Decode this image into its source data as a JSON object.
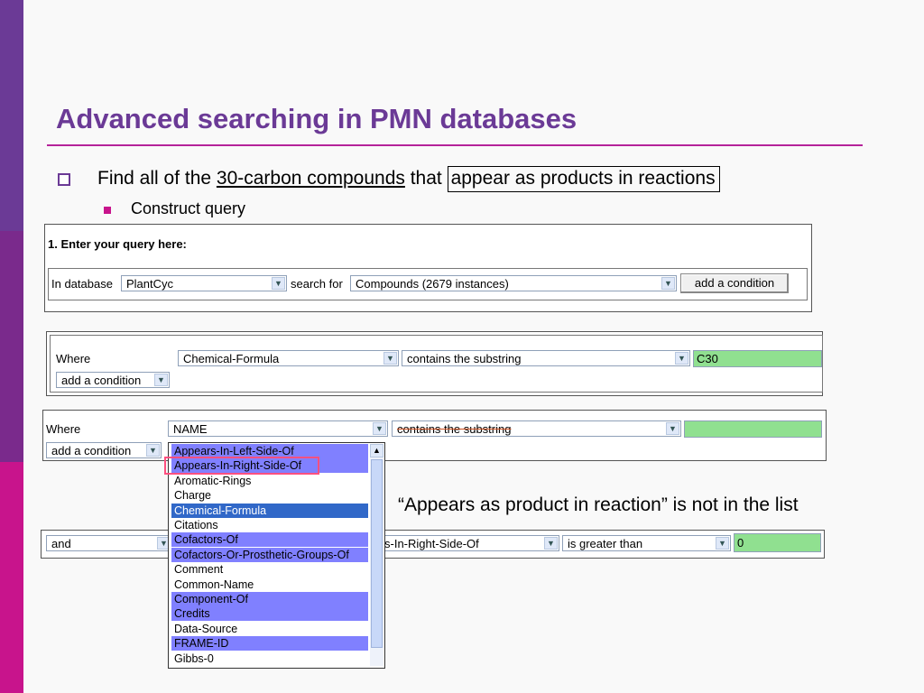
{
  "slide": {
    "title": "Advanced searching in PMN databases",
    "bullet1_prefix": "Find all of the ",
    "bullet1_underlined": "30-carbon compounds",
    "bullet1_middle": " that ",
    "bullet1_boxed": "appear as products in reactions",
    "bullet2": "Construct query",
    "callout": "“Appears as product in reaction” is not in the list"
  },
  "query_panel": {
    "heading": "1. Enter your query here:",
    "in_database_label": "In database",
    "database_value": "PlantCyc",
    "search_for_label": "search for",
    "search_for_value": "Compounds (2679 instances)",
    "add_condition_button": "add a condition"
  },
  "condition1": {
    "where_label": "Where",
    "attribute": "Chemical-Formula",
    "operator": "contains the substring",
    "value": "C30",
    "add_condition": "add a condition"
  },
  "condition2": {
    "where_label": "Where",
    "attribute": "NAME",
    "operator": "contains the substring",
    "value": "",
    "add_condition": "add a condition"
  },
  "condition3": {
    "conjunction": "and",
    "attribute": "s-In-Right-Side-Of",
    "operator": "is greater than",
    "value": "0"
  },
  "dropdown": {
    "items": [
      "Appears-In-Left-Side-Of",
      "Appears-In-Right-Side-Of",
      "Aromatic-Rings",
      "Charge",
      "Chemical-Formula",
      "Citations",
      "Cofactors-Of",
      "Cofactors-Or-Prosthetic-Groups-Of",
      "Comment",
      "Common-Name",
      "Component-Of",
      "Credits",
      "Data-Source",
      "FRAME-ID",
      "Gibbs-0"
    ],
    "highlighted": [
      0,
      1,
      6,
      7,
      10,
      11,
      13
    ],
    "selected": 4
  },
  "colors": {
    "title": "#6b3a96",
    "accent": "#c8148c",
    "value_field": "#90e090",
    "highlight": "#8080ff",
    "selected": "#3168c8"
  }
}
